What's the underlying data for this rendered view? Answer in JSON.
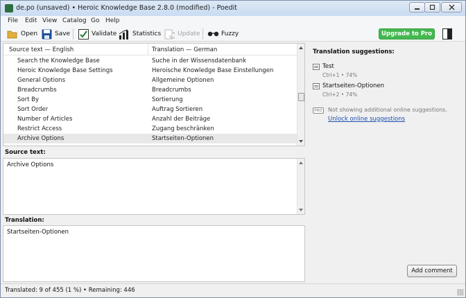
{
  "window": {
    "title": "de.po (unsaved) • Heroic Knowledge Base 2.8.0 (modified) - Poedit"
  },
  "menu": [
    "File",
    "Edit",
    "View",
    "Catalog",
    "Go",
    "Help"
  ],
  "toolbar": {
    "open": "Open",
    "save": "Save",
    "validate": "Validate",
    "statistics": "Statistics",
    "update": "Update",
    "fuzzy": "Fuzzy",
    "upgrade": "Upgrade to Pro"
  },
  "list": {
    "col_source": "Source text — English",
    "col_translation": "Translation — German",
    "rows": [
      {
        "source": "Search the Knowledge Base",
        "translation": "Suche in der Wissensdatenbank"
      },
      {
        "source": "Heroic Knowledge Base Settings",
        "translation": "Heroische Knowledge Base Einstellungen"
      },
      {
        "source": "General Options",
        "translation": "Allgemeine Optionen"
      },
      {
        "source": "Breadcrumbs",
        "translation": "Breadcrumbs"
      },
      {
        "source": "Sort By",
        "translation": "Sortierung"
      },
      {
        "source": "Sort Order",
        "translation": "Auftrag Sortieren"
      },
      {
        "source": "Number of Articles",
        "translation": "Anzahl der Beiträge"
      },
      {
        "source": "Restrict Access",
        "translation": "Zugang beschränken"
      },
      {
        "source": "Archive Options",
        "translation": "Startseiten-Optionen"
      }
    ]
  },
  "source_panel": {
    "label": "Source text:",
    "text": "Archive Options"
  },
  "translation_panel": {
    "label": "Translation:",
    "text": "Startseiten-Optionen"
  },
  "sidebar": {
    "title": "Translation suggestions:",
    "suggestions": [
      {
        "text": "Test",
        "meta": "Ctrl+1 • 74%"
      },
      {
        "text": "Startseiten-Optionen",
        "meta": "Ctrl+2 • 74%"
      }
    ],
    "pro_badge": "PRO",
    "pro_note": "Not showing additional online suggestions.",
    "unlock_link": "Unlock online suggestions",
    "add_comment": "Add comment"
  },
  "status": {
    "text": "Translated: 9 of 455 (1 %)  •  Remaining: 446"
  }
}
